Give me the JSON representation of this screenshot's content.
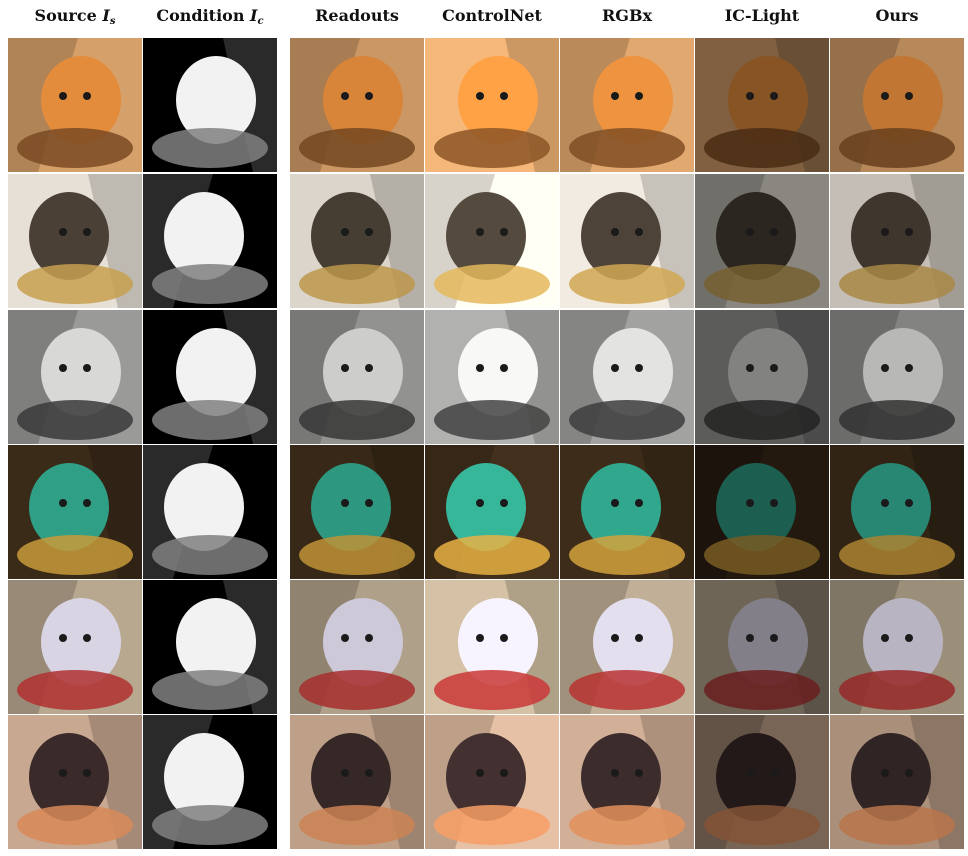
{
  "figure": {
    "columns": [
      {
        "id": "source",
        "label": "Source ",
        "math": "I",
        "sub": "s"
      },
      {
        "id": "condition",
        "label": "Condition ",
        "math": "I",
        "sub": "c"
      },
      {
        "id": "readouts",
        "label": "Readouts"
      },
      {
        "id": "controlnet",
        "label": "ControlNet"
      },
      {
        "id": "rgbx",
        "label": "RGBx"
      },
      {
        "id": "iclight",
        "label": "IC-Light"
      },
      {
        "id": "ours",
        "label": "Ours"
      }
    ],
    "rows": [
      {
        "id": "shiba-dog-on-bread",
        "colors": {
          "bg": "#d6a06a",
          "subject": "#e38c3c",
          "accent": "#7a4a22"
        }
      },
      {
        "id": "lion-sketch",
        "colors": {
          "bg": "#e6e0d6",
          "subject": "#4a4036",
          "accent": "#c7a050"
        }
      },
      {
        "id": "tabby-cat",
        "colors": {
          "bg": "#9a9a98",
          "subject": "#d8d8d6",
          "accent": "#3a3a3a"
        }
      },
      {
        "id": "woman-gold-headdress",
        "colors": {
          "bg": "#3a2a18",
          "subject": "#2f9f86",
          "accent": "#c89a3a"
        }
      },
      {
        "id": "street-people",
        "colors": {
          "bg": "#b8a890",
          "subject": "#d8d4e4",
          "accent": "#b03030"
        }
      },
      {
        "id": "two-women-reading",
        "colors": {
          "bg": "#c8a890",
          "subject": "#3a2a2a",
          "accent": "#d88a58"
        }
      }
    ]
  }
}
